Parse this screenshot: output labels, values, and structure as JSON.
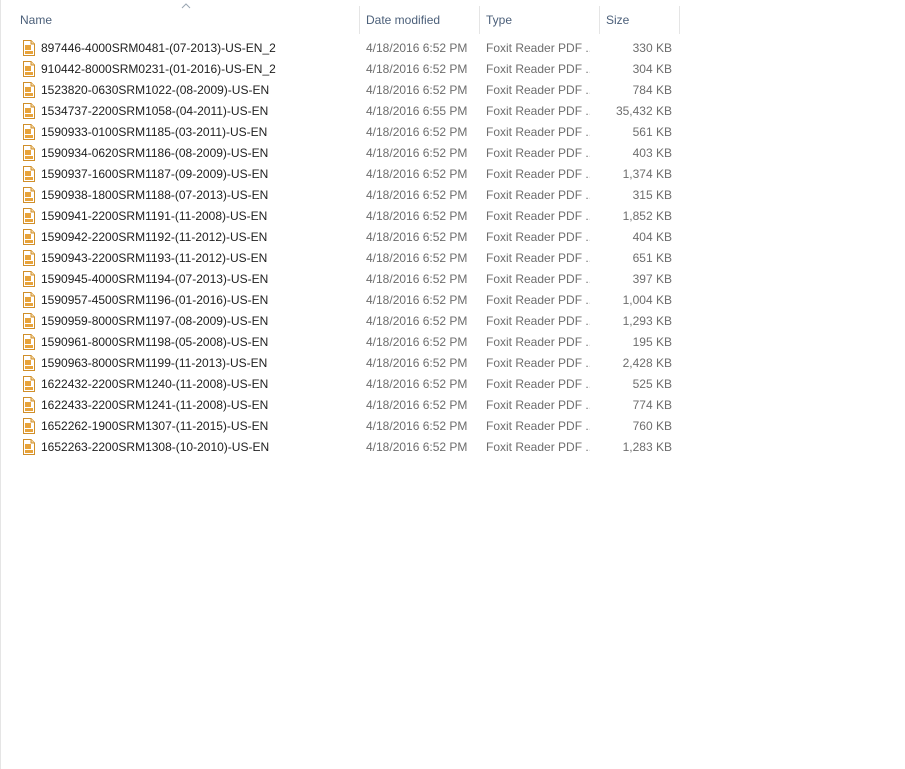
{
  "columns": {
    "name": "Name",
    "date": "Date modified",
    "type": "Type",
    "size": "Size"
  },
  "icon": "pdf-file-icon",
  "colors": {
    "header_text": "#4c607a",
    "name_text": "#1e1e1e",
    "meta_text": "#6d6d6d",
    "icon_accent": "#e8a33a"
  },
  "files": [
    {
      "name": "897446-4000SRM0481-(07-2013)-US-EN_2",
      "date": "4/18/2016 6:52 PM",
      "type": "Foxit Reader PDF ...",
      "size": "330 KB"
    },
    {
      "name": "910442-8000SRM0231-(01-2016)-US-EN_2",
      "date": "4/18/2016 6:52 PM",
      "type": "Foxit Reader PDF ...",
      "size": "304 KB"
    },
    {
      "name": "1523820-0630SRM1022-(08-2009)-US-EN",
      "date": "4/18/2016 6:52 PM",
      "type": "Foxit Reader PDF ...",
      "size": "784 KB"
    },
    {
      "name": "1534737-2200SRM1058-(04-2011)-US-EN",
      "date": "4/18/2016 6:55 PM",
      "type": "Foxit Reader PDF ...",
      "size": "35,432 KB"
    },
    {
      "name": "1590933-0100SRM1185-(03-2011)-US-EN",
      "date": "4/18/2016 6:52 PM",
      "type": "Foxit Reader PDF ...",
      "size": "561 KB"
    },
    {
      "name": "1590934-0620SRM1186-(08-2009)-US-EN",
      "date": "4/18/2016 6:52 PM",
      "type": "Foxit Reader PDF ...",
      "size": "403 KB"
    },
    {
      "name": "1590937-1600SRM1187-(09-2009)-US-EN",
      "date": "4/18/2016 6:52 PM",
      "type": "Foxit Reader PDF ...",
      "size": "1,374 KB"
    },
    {
      "name": "1590938-1800SRM1188-(07-2013)-US-EN",
      "date": "4/18/2016 6:52 PM",
      "type": "Foxit Reader PDF ...",
      "size": "315 KB"
    },
    {
      "name": "1590941-2200SRM1191-(11-2008)-US-EN",
      "date": "4/18/2016 6:52 PM",
      "type": "Foxit Reader PDF ...",
      "size": "1,852 KB"
    },
    {
      "name": "1590942-2200SRM1192-(11-2012)-US-EN",
      "date": "4/18/2016 6:52 PM",
      "type": "Foxit Reader PDF ...",
      "size": "404 KB"
    },
    {
      "name": "1590943-2200SRM1193-(11-2012)-US-EN",
      "date": "4/18/2016 6:52 PM",
      "type": "Foxit Reader PDF ...",
      "size": "651 KB"
    },
    {
      "name": "1590945-4000SRM1194-(07-2013)-US-EN",
      "date": "4/18/2016 6:52 PM",
      "type": "Foxit Reader PDF ...",
      "size": "397 KB"
    },
    {
      "name": "1590957-4500SRM1196-(01-2016)-US-EN",
      "date": "4/18/2016 6:52 PM",
      "type": "Foxit Reader PDF ...",
      "size": "1,004 KB"
    },
    {
      "name": "1590959-8000SRM1197-(08-2009)-US-EN",
      "date": "4/18/2016 6:52 PM",
      "type": "Foxit Reader PDF ...",
      "size": "1,293 KB"
    },
    {
      "name": "1590961-8000SRM1198-(05-2008)-US-EN",
      "date": "4/18/2016 6:52 PM",
      "type": "Foxit Reader PDF ...",
      "size": "195 KB"
    },
    {
      "name": "1590963-8000SRM1199-(11-2013)-US-EN",
      "date": "4/18/2016 6:52 PM",
      "type": "Foxit Reader PDF ...",
      "size": "2,428 KB"
    },
    {
      "name": "1622432-2200SRM1240-(11-2008)-US-EN",
      "date": "4/18/2016 6:52 PM",
      "type": "Foxit Reader PDF ...",
      "size": "525 KB"
    },
    {
      "name": "1622433-2200SRM1241-(11-2008)-US-EN",
      "date": "4/18/2016 6:52 PM",
      "type": "Foxit Reader PDF ...",
      "size": "774 KB"
    },
    {
      "name": "1652262-1900SRM1307-(11-2015)-US-EN",
      "date": "4/18/2016 6:52 PM",
      "type": "Foxit Reader PDF ...",
      "size": "760 KB"
    },
    {
      "name": "1652263-2200SRM1308-(10-2010)-US-EN",
      "date": "4/18/2016 6:52 PM",
      "type": "Foxit Reader PDF ...",
      "size": "1,283 KB"
    }
  ]
}
